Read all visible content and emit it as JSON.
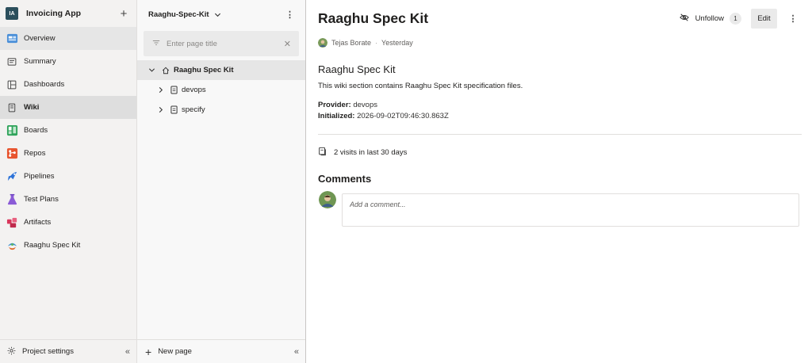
{
  "nav": {
    "project_initials": "IA",
    "project_name": "Invoicing App",
    "items": [
      {
        "label": "Overview",
        "icon": "overview-icon"
      },
      {
        "label": "Summary",
        "icon": "summary-icon"
      },
      {
        "label": "Dashboards",
        "icon": "dashboards-icon"
      },
      {
        "label": "Wiki",
        "icon": "wiki-icon"
      },
      {
        "label": "Boards",
        "icon": "boards-icon"
      },
      {
        "label": "Repos",
        "icon": "repos-icon"
      },
      {
        "label": "Pipelines",
        "icon": "pipelines-icon"
      },
      {
        "label": "Test Plans",
        "icon": "test-plans-icon"
      },
      {
        "label": "Artifacts",
        "icon": "artifacts-icon"
      },
      {
        "label": "Raaghu Spec Kit",
        "icon": "spec-kit-icon"
      }
    ],
    "footer_label": "Project settings"
  },
  "tree": {
    "wiki_name": "Raaghu-Spec-Kit",
    "filter_placeholder": "Enter page title",
    "root": "Raaghu Spec Kit",
    "children": [
      "devops",
      "specify"
    ],
    "new_page_label": "New page"
  },
  "page": {
    "title": "Raaghu Spec Kit",
    "unfollow_label": "Unfollow",
    "follower_count": "1",
    "edit_label": "Edit",
    "author": "Tejas Borate",
    "updated": "Yesterday",
    "heading": "Raaghu Spec Kit",
    "description": "This wiki section contains Raaghu Spec Kit specification files.",
    "provider_key": "Provider:",
    "provider_value": "devops",
    "initialized_key": "Initialized:",
    "initialized_value": "2026-09-02T09:46:30.863Z",
    "visits": "2 visits in last 30 days",
    "comments_heading": "Comments",
    "comment_placeholder": "Add a comment..."
  },
  "colors": {
    "accent": "#0078d4",
    "nav_bg": "#f3f2f1",
    "tree_bg": "#f8f8f8"
  }
}
